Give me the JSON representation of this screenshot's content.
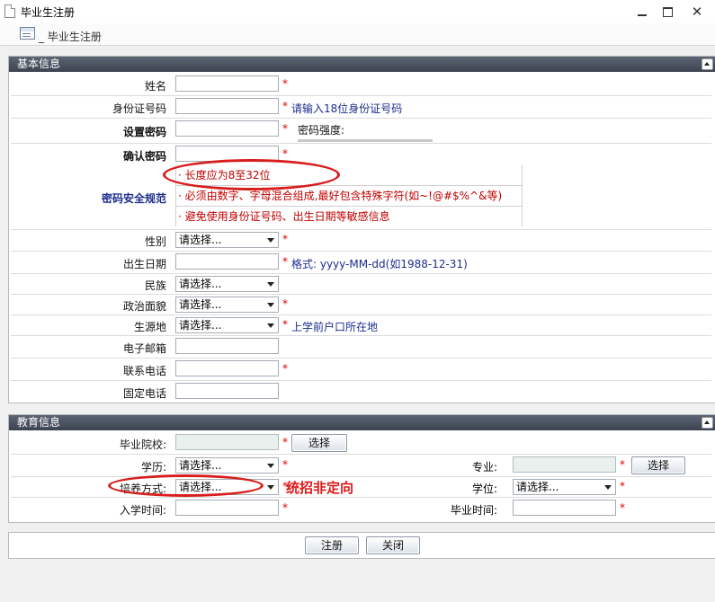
{
  "window": {
    "title": "毕业生注册"
  },
  "breadcrumb": {
    "text": "_ 毕业生注册"
  },
  "basic": {
    "header": "基本信息",
    "name_label": "姓名",
    "id_label": "身份证号码",
    "id_hint": "请输入18位身份证号码",
    "password_label": "设置密码",
    "strength_label": "密码强度:",
    "confirm_label": "确认密码",
    "rules_label": "密码安全规范",
    "rules": [
      "· 长度应为8至32位",
      "· 必须由数字、字母混合组成,最好包含特殊字符(如~!@#$%^&等)",
      "· 避免使用身份证号码、出生日期等敏感信息"
    ],
    "gender_label": "性别",
    "gender_value": "请选择...",
    "birth_label": "出生日期",
    "birth_hint": "格式: yyyy-MM-dd(如1988-12-31)",
    "ethnic_label": "民族",
    "ethnic_value": "请选择...",
    "political_label": "政治面貌",
    "political_value": "请选择...",
    "origin_label": "生源地",
    "origin_value": "请选择...",
    "origin_hint": "上学前户口所在地",
    "email_label": "电子邮箱",
    "phone_label": "联系电话",
    "landline_label": "固定电话",
    "required_mark": "*"
  },
  "education": {
    "header": "教育信息",
    "school_label": "毕业院校:",
    "select_button": "选择",
    "degree_level_label": "学历:",
    "degree_level_value": "请选择...",
    "major_label": "专业:",
    "major_select_button": "选择",
    "training_label": "培养方式:",
    "training_value": "请选择...",
    "training_annotation": "统招非定向",
    "degree_label": "学位:",
    "degree_value": "请选择...",
    "enroll_label": "入学时间:",
    "graduate_label": "毕业时间:"
  },
  "footer": {
    "register_button": "注册",
    "close_button": "关闭"
  },
  "colors": {
    "header_bg": "#4b5361",
    "required": "#e00000",
    "hint": "#1c2d8c",
    "rule_text": "#c00000",
    "annotation": "#d81d1d"
  }
}
